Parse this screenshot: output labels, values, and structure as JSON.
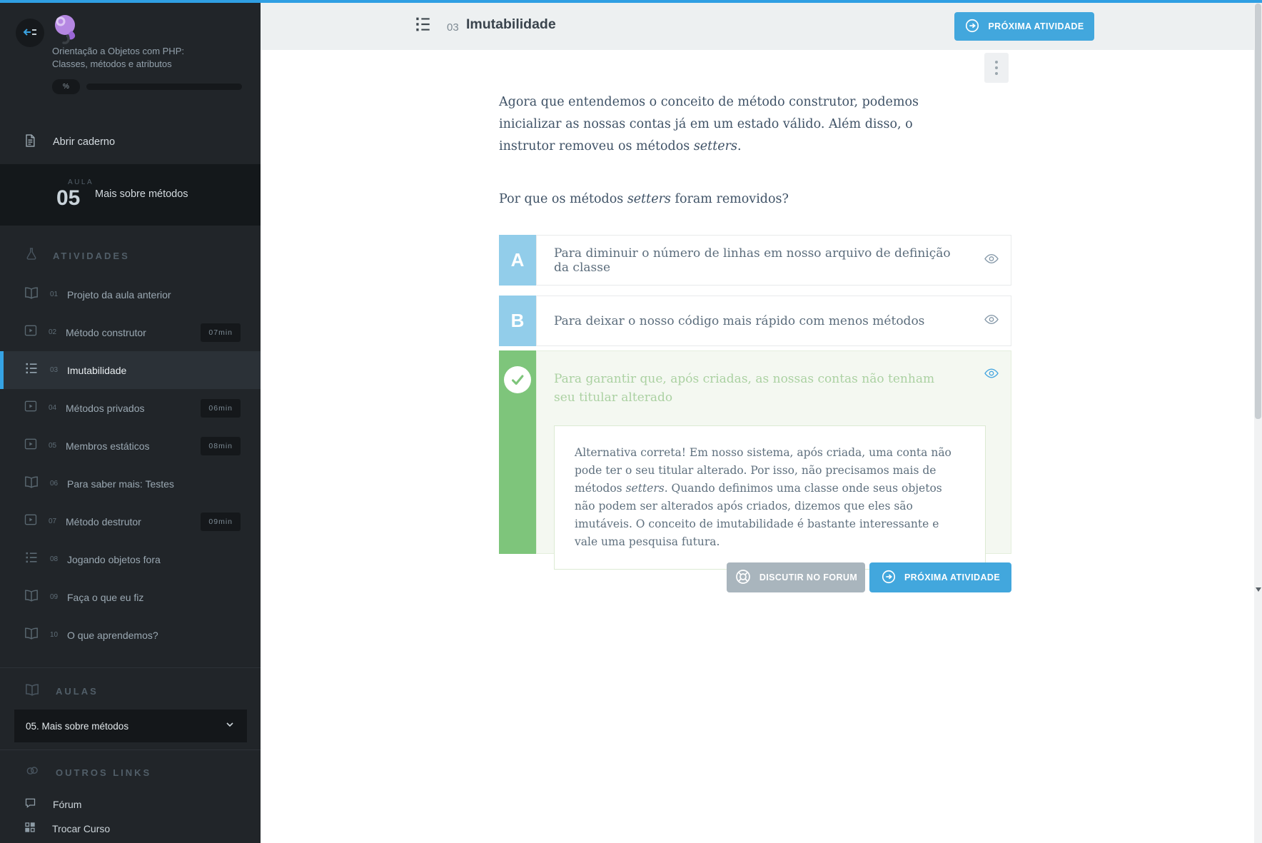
{
  "colors": {
    "accent_blue": "#42a7dd",
    "topline_blue": "#2f9fe3",
    "correct_green": "#7ec57b",
    "option_letter_blue": "#92cdea",
    "gray_button": "#a9b5bd"
  },
  "course": {
    "title_line1": "Orientação a Objetos com PHP:",
    "title_line2": "Classes, métodos e atributos",
    "progress_badge": "%"
  },
  "sidebar": {
    "open_notebook": "Abrir caderno",
    "lesson": {
      "label": "AULA",
      "number": "05",
      "title": "Mais sobre métodos"
    },
    "activities_header": "ATIVIDADES",
    "activities": [
      {
        "num": "01",
        "label": "Projeto da aula anterior",
        "icon": "book-icon",
        "duration": ""
      },
      {
        "num": "02",
        "label": "Método construtor",
        "icon": "video-icon",
        "duration": "07min"
      },
      {
        "num": "03",
        "label": "Imutabilidade",
        "icon": "list-icon",
        "duration": "",
        "active": true
      },
      {
        "num": "04",
        "label": "Métodos privados",
        "icon": "video-icon",
        "duration": "06min"
      },
      {
        "num": "05",
        "label": "Membros estáticos",
        "icon": "video-icon",
        "duration": "08min"
      },
      {
        "num": "06",
        "label": "Para saber mais: Testes",
        "icon": "book-icon",
        "duration": ""
      },
      {
        "num": "07",
        "label": "Método destrutor",
        "icon": "video-icon",
        "duration": "09min"
      },
      {
        "num": "08",
        "label": "Jogando objetos fora",
        "icon": "list-icon",
        "duration": ""
      },
      {
        "num": "09",
        "label": "Faça o que eu fiz",
        "icon": "book-icon",
        "duration": ""
      },
      {
        "num": "10",
        "label": "O que aprendemos?",
        "icon": "book-icon",
        "duration": ""
      }
    ],
    "aulas_header": "AULAS",
    "aulas_selected": "05. Mais sobre métodos",
    "outros_links_header": "OUTROS LINKS",
    "forum": "Fórum",
    "trocar_curso": "Trocar Curso"
  },
  "header": {
    "activity_number": "03",
    "title": "Imutabilidade",
    "next_button": "PRÓXIMA ATIVIDADE"
  },
  "question": {
    "p1_before": "Agora que entendemos o conceito de método construtor, podemos inicializar as nossas contas já em um estado válido. Além disso, o instrutor removeu os métodos ",
    "p1_italic": "setters",
    "p1_after": ".",
    "p2_before": "Por que os métodos ",
    "p2_italic": "setters",
    "p2_after": " foram removidos?"
  },
  "options": {
    "a": {
      "letter": "A",
      "text": "Para diminuir o número de linhas em nosso arquivo de definição da classe"
    },
    "b": {
      "letter": "B",
      "text": "Para deixar o nosso código mais rápido com menos métodos"
    },
    "correct": {
      "text": "Para garantir que, após criadas, as nossas contas não tenham seu titular alterado"
    }
  },
  "explanation": {
    "before": "Alternativa correta! Em nosso sistema, após criada, uma conta não pode ter o seu titular alterado. Por isso, não precisamos mais de métodos ",
    "italic": "setters",
    "after": ". Quando definimos uma classe onde seus objetos não podem ser alterados após criados, dizemos que eles são imutáveis. O conceito de imutabilidade é bastante interessante e vale uma pesquisa futura."
  },
  "footer": {
    "discuss_button": "DISCUTIR NO FORUM",
    "next_button": "PRÓXIMA ATIVIDADE"
  }
}
